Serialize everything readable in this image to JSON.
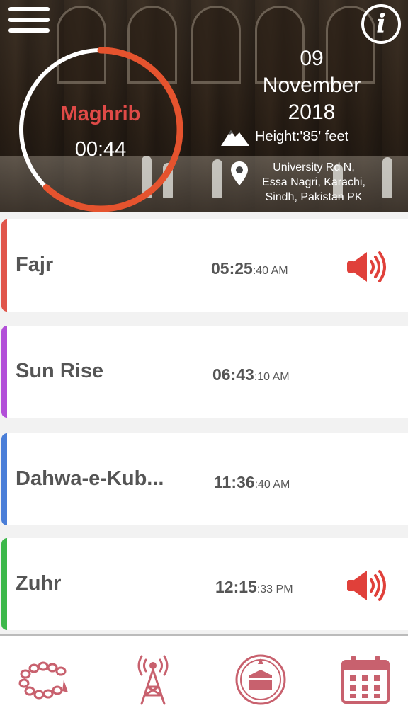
{
  "header": {
    "current_prayer": "Maghrib",
    "countdown": "00:44",
    "progress": 0.62,
    "date": {
      "day": "09",
      "month": "November",
      "year": "2018"
    },
    "height": "Height:'85' feet",
    "address": [
      "University Rd N,",
      "Essa Nagri, Karachi,",
      "Sindh, Pakistan PK"
    ],
    "icons": {
      "menu": "hamburger-menu-icon",
      "info": "info-icon",
      "mountain": "mountain-icon",
      "location": "location-pin-icon"
    },
    "info_symbol": "i"
  },
  "prayers": [
    {
      "name": "Fajr",
      "time_main": "05:25",
      "time_sec": ":40 AM",
      "color": "#e0554a",
      "alarm": true
    },
    {
      "name": "Sun Rise",
      "time_main": "06:43",
      "time_sec": ":10 AM",
      "color": "#b24fd8",
      "alarm": false
    },
    {
      "name": "Dahwa-e-Kub...",
      "time_main": "11:36",
      "time_sec": ":40 AM",
      "color": "#4a7ed8",
      "alarm": false
    },
    {
      "name": "Zuhr",
      "time_main": "12:15",
      "time_sec": ":33 PM",
      "color": "#3cb84a",
      "alarm": true
    }
  ],
  "bottom_nav": [
    {
      "icon": "tasbih-beads-icon"
    },
    {
      "icon": "radio-tower-icon"
    },
    {
      "icon": "kaaba-compass-icon"
    },
    {
      "icon": "calendar-icon"
    }
  ],
  "colors": {
    "accent": "#e04a47",
    "nav_icon": "#c8616e",
    "ring_track": "#ffffff"
  }
}
